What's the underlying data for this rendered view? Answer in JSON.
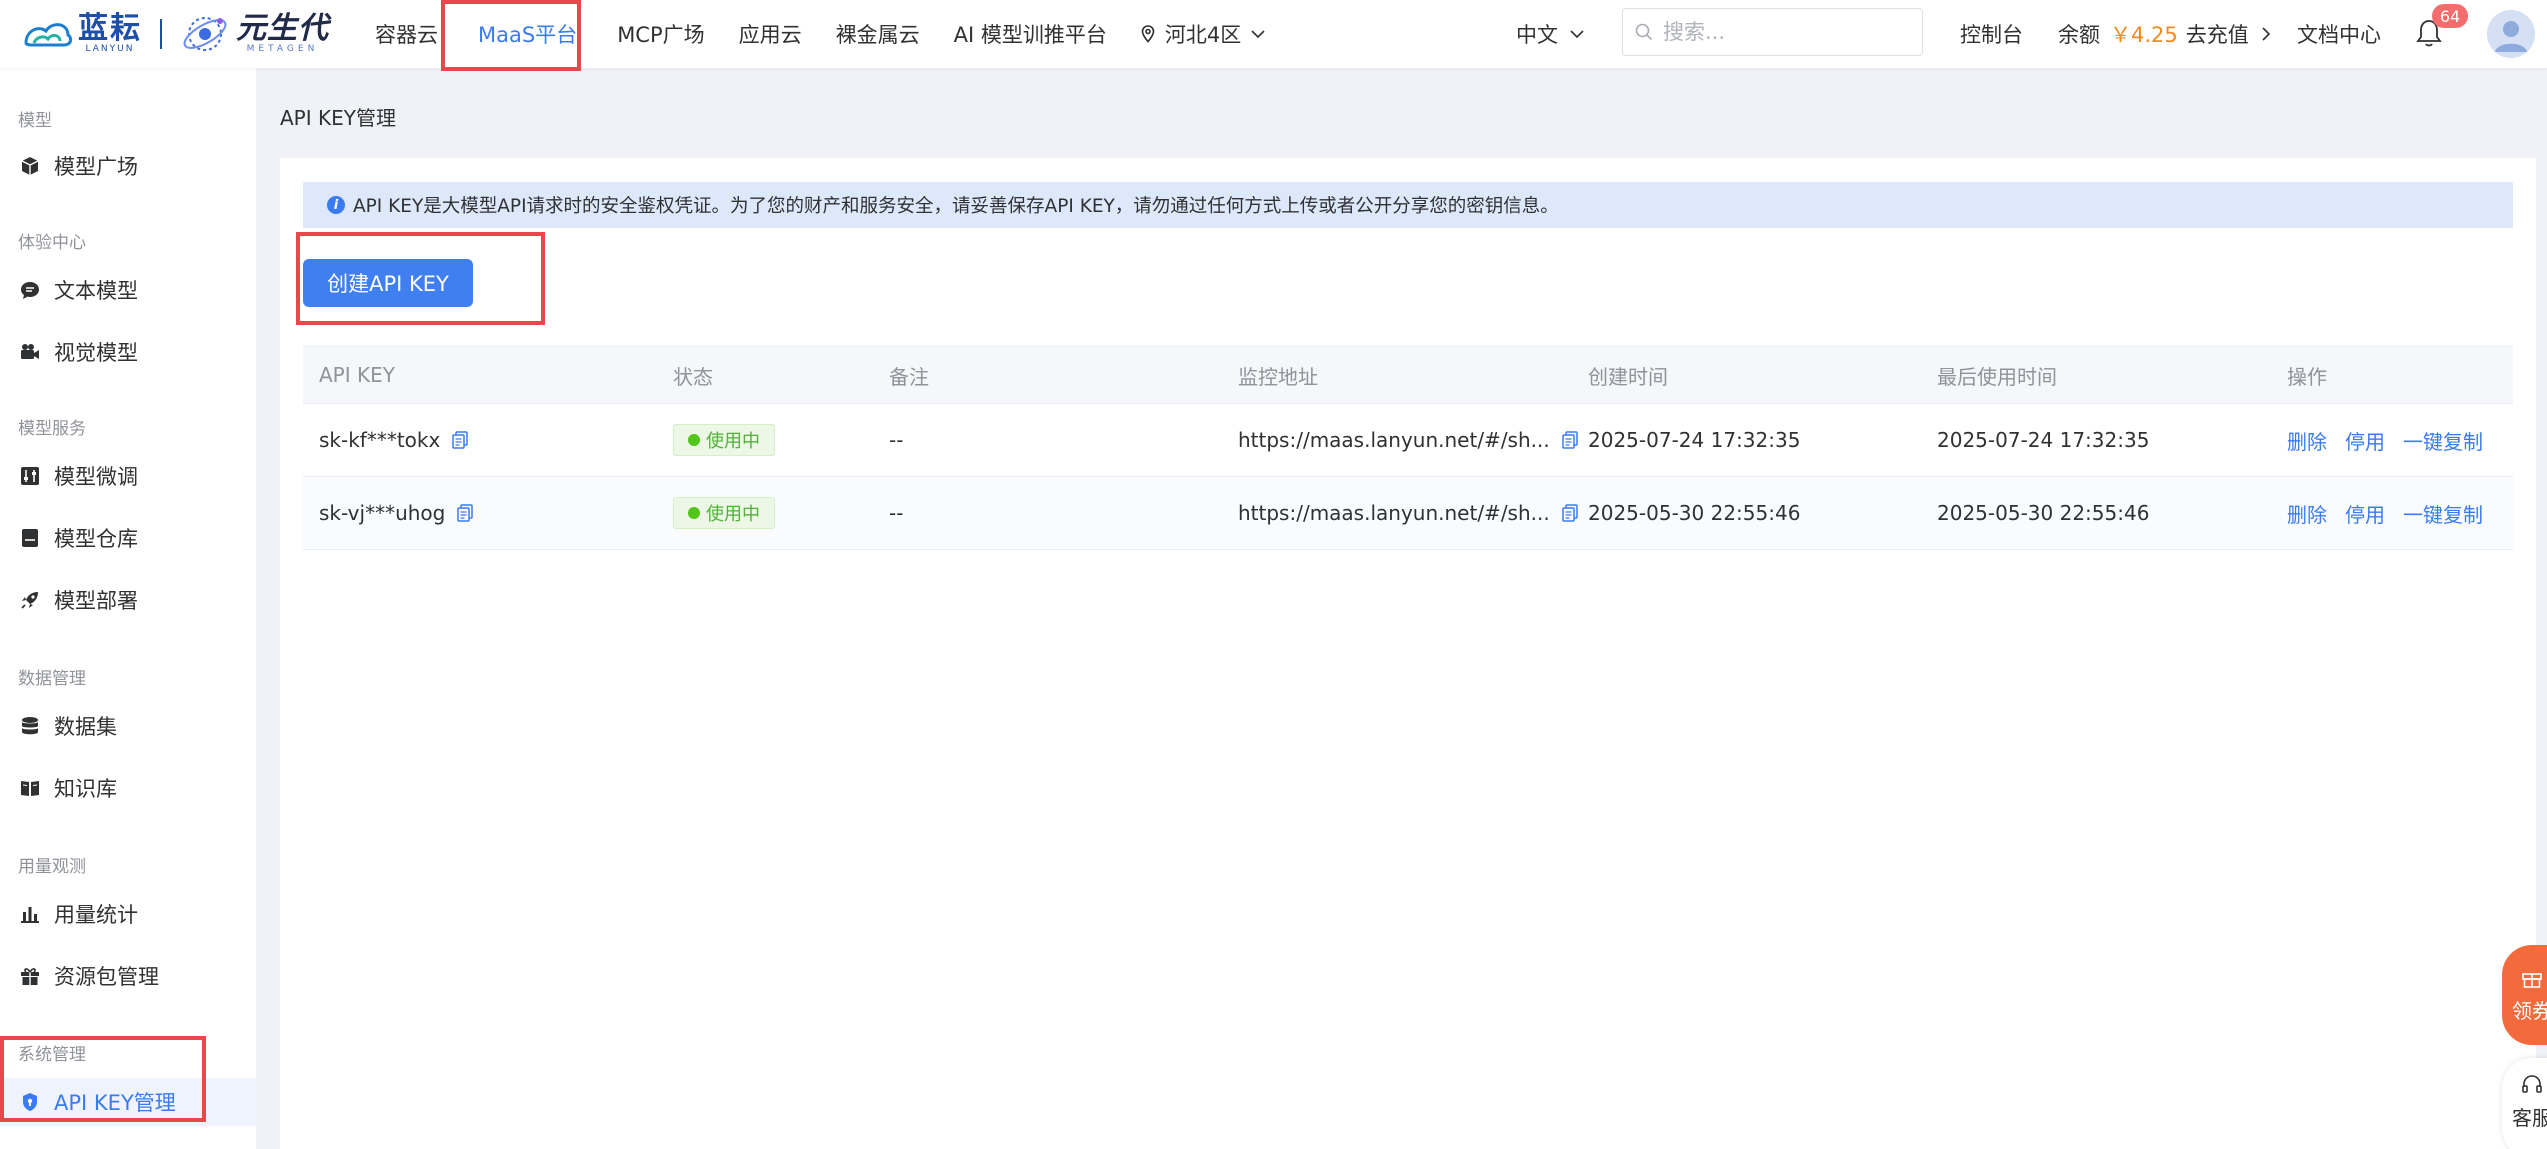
{
  "brand": {
    "logo1_cn": "蓝耘",
    "logo1_en": "LANYUN",
    "logo2_cn": "元生代",
    "logo2_en": "METAGEN"
  },
  "nav": {
    "items": [
      "容器云",
      "MaaS平台",
      "MCP广场",
      "应用云",
      "裸金属云",
      "AI 模型训推平台"
    ],
    "active": "MaaS平台",
    "region": "河北4区"
  },
  "header": {
    "language": "中文",
    "search_placeholder": "搜索...",
    "console": "控制台",
    "balance_label": "余额",
    "balance_amount": "￥4.25",
    "recharge": "去充值",
    "docs": "文档中心",
    "notification_count": "64"
  },
  "sidebar": {
    "groups": [
      {
        "title": "模型",
        "items": [
          "模型广场"
        ]
      },
      {
        "title": "体验中心",
        "items": [
          "文本模型",
          "视觉模型"
        ]
      },
      {
        "title": "模型服务",
        "items": [
          "模型微调",
          "模型仓库",
          "模型部署"
        ]
      },
      {
        "title": "数据管理",
        "items": [
          "数据集",
          "知识库"
        ]
      },
      {
        "title": "用量观测",
        "items": [
          "用量统计",
          "资源包管理"
        ]
      },
      {
        "title": "系统管理",
        "items": [
          "API KEY管理"
        ]
      }
    ],
    "active": "API KEY管理"
  },
  "main": {
    "page_title": "API KEY管理",
    "notice": "API KEY是大模型API请求时的安全鉴权凭证。为了您的财产和服务安全，请妥善保存API KEY，请勿通过任何方式上传或者公开分享您的密钥信息。",
    "create_button": "创建API KEY",
    "table": {
      "headers": [
        "API KEY",
        "状态",
        "备注",
        "监控地址",
        "创建时间",
        "最后使用时间",
        "操作"
      ],
      "rows": [
        {
          "key": "sk-kf***tokx",
          "status": "使用中",
          "remark": "--",
          "monitor_url": "https://maas.lanyun.net/#/sh...",
          "created": "2025-07-24 17:32:35",
          "last_used": "2025-07-24 17:32:35"
        },
        {
          "key": "sk-vj***uhog",
          "status": "使用中",
          "remark": "--",
          "monitor_url": "https://maas.lanyun.net/#/sh...",
          "created": "2025-05-30 22:55:46",
          "last_used": "2025-05-30 22:55:46"
        }
      ],
      "actions": [
        "删除",
        "停用",
        "一键复制"
      ]
    }
  },
  "floating": {
    "coupon": "领券",
    "service": "客服"
  },
  "colors": {
    "accent": "#3a7bf0",
    "highlight_box": "#e8474c",
    "balance": "#f28b1c",
    "status_green": "#52c41a"
  }
}
